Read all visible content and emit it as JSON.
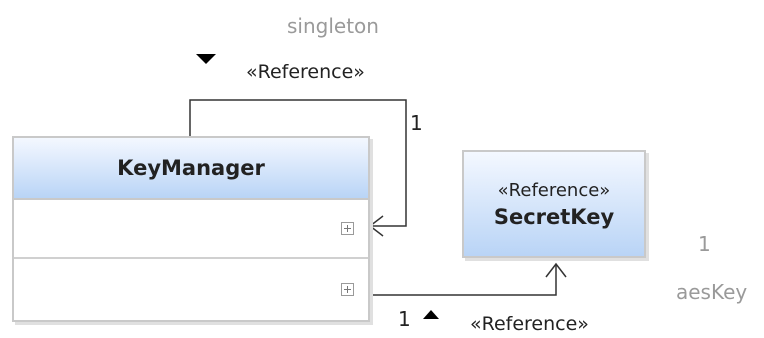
{
  "classes": {
    "key_manager": {
      "name": "KeyManager"
    },
    "secret_key": {
      "stereotype": "«Reference»",
      "name": "SecretKey"
    }
  },
  "associations": {
    "singleton": {
      "role": "singleton",
      "stereotype": "«Reference»",
      "multiplicity": "1"
    },
    "aes_key": {
      "role": "aesKey",
      "stereotype": "«Reference»",
      "multiplicity_target": "1",
      "multiplicity_source": "1"
    }
  },
  "colors": {
    "header_gradient_top": "#f4f8ff",
    "header_gradient_bottom": "#b9d4f6",
    "border": "#c9c9c9",
    "label_grey": "#9a9a9a",
    "text_dark": "#222222"
  }
}
